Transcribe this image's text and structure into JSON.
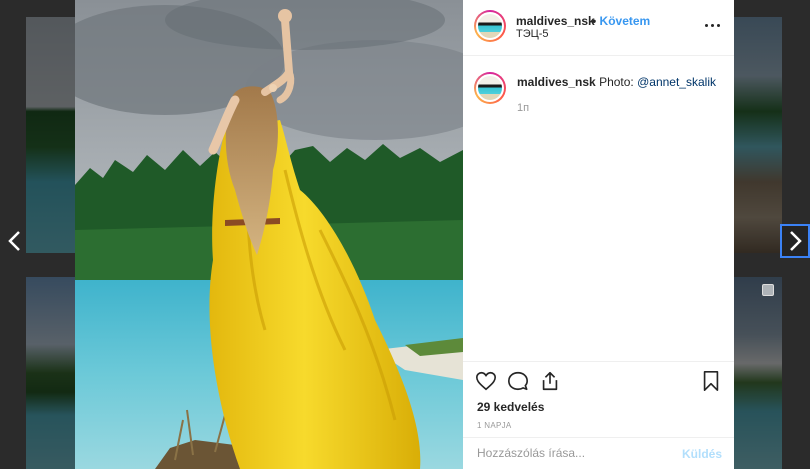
{
  "post": {
    "username": "maldives_nsk",
    "follow_label": "Követem",
    "location": "ТЭЦ-5",
    "caption_prefix": "Photo: ",
    "caption_mention": "@annet_skalik",
    "time_ago": "1п",
    "likes": "29 kedvelés",
    "date": "1 NAPJA"
  },
  "comment": {
    "placeholder": "Hozzászólás írása...",
    "submit_label": "Küldés"
  },
  "icons": {
    "nav_prev": "chevron-left-icon",
    "nav_next": "chevron-right-icon",
    "more": "more-options-icon",
    "like": "heart-icon",
    "comment": "comment-bubble-icon",
    "share": "share-icon",
    "save": "bookmark-icon"
  },
  "colors": {
    "follow": "#3897f0",
    "mention": "#003569",
    "submit_disabled": "#b2dffc",
    "nav_focus": "#3b82f6"
  }
}
